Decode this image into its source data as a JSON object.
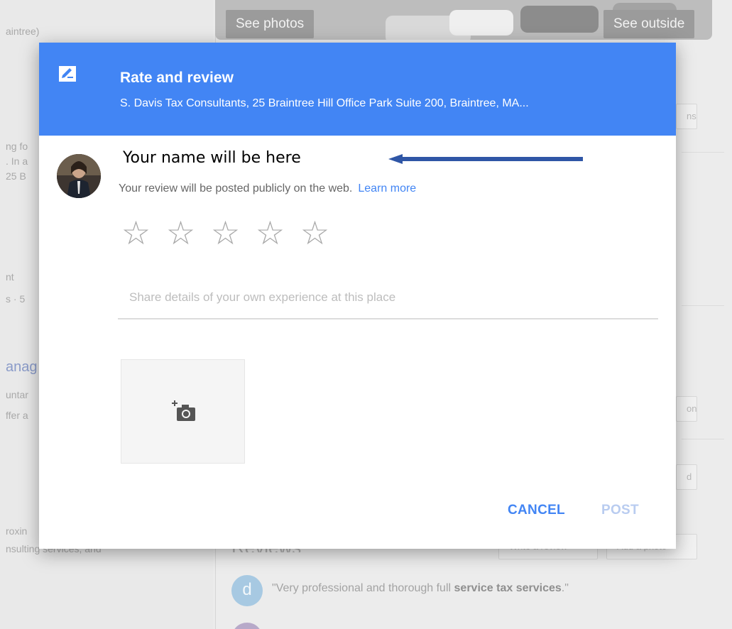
{
  "background": {
    "left_fragments": [
      "aintree) of",
      "ng fo",
      ". In a",
      "25 B",
      "nt",
      "s · 5",
      "anag",
      "untar",
      "ffer a",
      "roxin",
      "nsulting services, and"
    ],
    "photo_buttons": {
      "see_photos": "See photos",
      "see_outside": "See outside"
    },
    "side_pills": [
      "ns",
      "on",
      "d"
    ],
    "reviews_heading": "Reviews",
    "review_actions": {
      "write": "Write a review",
      "add_photo": "Add a photo"
    },
    "sample_review": {
      "avatar_letter": "d",
      "text_start": "\"Very professional and thorough full ",
      "text_bold": "service tax services",
      "text_end": ".\""
    }
  },
  "dialog": {
    "title": "Rate and review",
    "subtitle": "S. Davis Tax Consultants, 25 Braintree Hill Office Park Suite 200, Braintree, MA...",
    "user_name": "Your name will be here",
    "notice": "Your review will be posted publicly on the web.",
    "learn_more": "Learn more",
    "stars": [
      "☆",
      "☆",
      "☆",
      "☆",
      "☆"
    ],
    "review_placeholder": "Share details of your own experience at this place",
    "cancel_label": "CANCEL",
    "post_label": "POST"
  },
  "colors": {
    "header_blue": "#4285f4",
    "link_blue": "#4285f4",
    "post_disabled": "#b9ccf0",
    "annotation_arrow": "#2f56a6"
  },
  "icons": {
    "header": "rate-review-icon",
    "camera": "add-photo-camera-icon",
    "annotation": "left-arrow-icon"
  }
}
